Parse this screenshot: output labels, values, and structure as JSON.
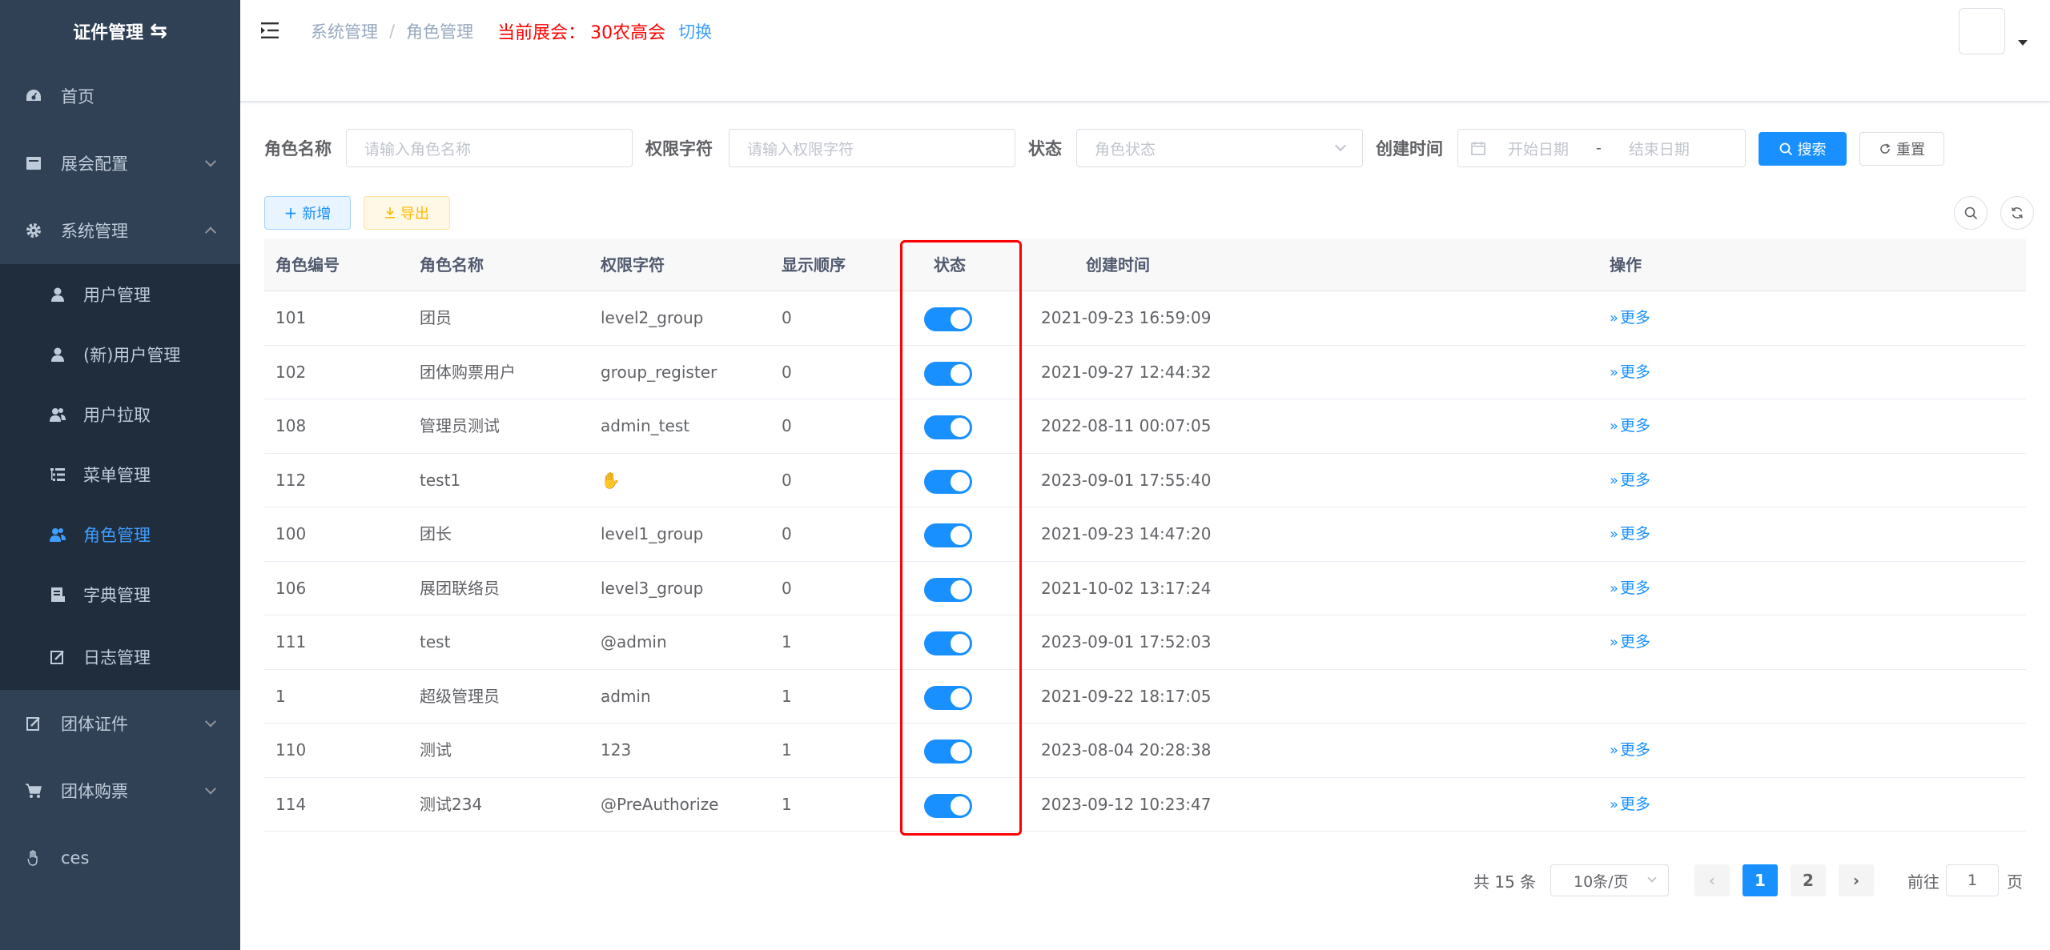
{
  "app": {
    "logo_text": "证件管理",
    "logo_icon": "swap-icon"
  },
  "sidebar": {
    "items": [
      {
        "label": "首页",
        "icon": "dashboard-icon"
      },
      {
        "label": "展会配置",
        "icon": "exhibition-icon"
      },
      {
        "label": "系统管理",
        "icon": "gear-icon",
        "expanded": true
      },
      {
        "label": "团体证件",
        "icon": "edit-icon"
      },
      {
        "label": "团体购票",
        "icon": "cart-icon"
      },
      {
        "label": "ces",
        "icon": "hand-icon"
      }
    ],
    "sub_items": [
      {
        "label": "用户管理",
        "icon": "user-icon"
      },
      {
        "label": "(新)用户管理",
        "icon": "user-icon"
      },
      {
        "label": "用户拉取",
        "icon": "peoples-icon"
      },
      {
        "label": "菜单管理",
        "icon": "tree-table-icon"
      },
      {
        "label": "角色管理",
        "icon": "peoples-icon",
        "active": true
      },
      {
        "label": "字典管理",
        "icon": "dict-icon"
      },
      {
        "label": "日志管理",
        "icon": "log-icon"
      }
    ]
  },
  "header": {
    "breadcrumb": [
      "系统管理",
      "角色管理"
    ],
    "breadcrumb_sep": "/",
    "current_expo_label": "当前展会：",
    "current_expo_value": "30农高会",
    "switch_label": "切换"
  },
  "filters": {
    "role_name_label": "角色名称",
    "role_name_placeholder": "请输入角色名称",
    "perm_label": "权限字符",
    "perm_placeholder": "请输入权限字符",
    "status_label": "状态",
    "status_placeholder": "角色状态",
    "created_label": "创建时间",
    "start_placeholder": "开始日期",
    "range_sep": "-",
    "end_placeholder": "结束日期",
    "search_button": "搜索",
    "reset_button": "重置"
  },
  "toolbar": {
    "add_button": "新增",
    "export_button": "导出"
  },
  "table": {
    "columns": [
      "角色编号",
      "角色名称",
      "权限字符",
      "显示顺序",
      "状态",
      "创建时间",
      "操作"
    ],
    "more_label": "更多",
    "rows": [
      {
        "id": "101",
        "name": "团员",
        "perm": "level2_group",
        "order": "0",
        "enabled": true,
        "created": "2021-09-23 16:59:09",
        "has_more": true
      },
      {
        "id": "102",
        "name": "团体购票用户",
        "perm": "group_register",
        "order": "0",
        "enabled": true,
        "created": "2021-09-27 12:44:32",
        "has_more": true
      },
      {
        "id": "108",
        "name": "管理员测试",
        "perm": "admin_test",
        "order": "0",
        "enabled": true,
        "created": "2022-08-11 00:07:05",
        "has_more": true
      },
      {
        "id": "112",
        "name": "test1",
        "perm": "✋",
        "order": "0",
        "enabled": true,
        "created": "2023-09-01 17:55:40",
        "has_more": true
      },
      {
        "id": "100",
        "name": "团长",
        "perm": "level1_group",
        "order": "0",
        "enabled": true,
        "created": "2021-09-23 14:47:20",
        "has_more": true
      },
      {
        "id": "106",
        "name": "展团联络员",
        "perm": "level3_group",
        "order": "0",
        "enabled": true,
        "created": "2021-10-02 13:17:24",
        "has_more": true
      },
      {
        "id": "111",
        "name": "test",
        "perm": "@admin",
        "order": "1",
        "enabled": true,
        "created": "2023-09-01 17:52:03",
        "has_more": true
      },
      {
        "id": "1",
        "name": "超级管理员",
        "perm": "admin",
        "order": "1",
        "enabled": true,
        "created": "2021-09-22 18:17:05",
        "has_more": false
      },
      {
        "id": "110",
        "name": "测试",
        "perm": "123",
        "order": "1",
        "enabled": true,
        "created": "2023-08-04 20:28:38",
        "has_more": true
      },
      {
        "id": "114",
        "name": "测试234",
        "perm": "@PreAuthorize",
        "order": "1",
        "enabled": true,
        "created": "2023-09-12 10:23:47",
        "has_more": true
      }
    ]
  },
  "pagination": {
    "total_text": "共 15 条",
    "page_size": "10条/页",
    "pages": [
      "1",
      "2"
    ],
    "current_page": "1",
    "jump_label": "前往",
    "jump_value": "1",
    "jump_unit": "页"
  },
  "colors": {
    "sidebar_bg": "#304156",
    "sidebar_sub_bg": "#1f2d3d",
    "primary": "#1890ff",
    "warning": "#ffba00",
    "highlight": "#ff0000"
  }
}
